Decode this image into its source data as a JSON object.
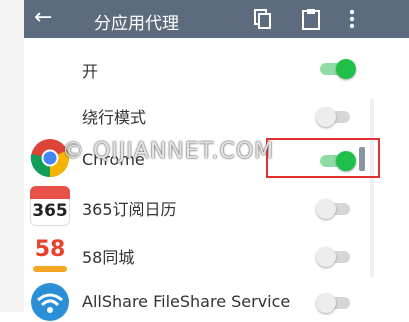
{
  "toolbar": {
    "title": "分应用代理",
    "back_icon": "arrow-left-icon",
    "actions": [
      "copy-icon",
      "clipboard-icon",
      "more-vert-icon"
    ]
  },
  "settings": [
    {
      "label": "开",
      "enabled": true
    },
    {
      "label": "绕行模式",
      "enabled": false
    }
  ],
  "apps": [
    {
      "label": "Chrome",
      "icon": "chrome-icon",
      "enabled": true
    },
    {
      "label": "365订阅日历",
      "icon": "calendar-365-icon",
      "icon_text": "365",
      "enabled": false
    },
    {
      "label": "58同城",
      "icon": "58-tongcheng-icon",
      "icon_text": "58",
      "enabled": false
    },
    {
      "label": "AllShare FileShare Service",
      "icon": "wifi-share-icon",
      "enabled": false
    }
  ],
  "watermark": "© QIJIANNET.COM",
  "colors": {
    "toolbar": "#5c6b7e",
    "switch_on": "#1ec04a",
    "switch_off": "#d6d6d6",
    "highlight": "#e03232"
  }
}
